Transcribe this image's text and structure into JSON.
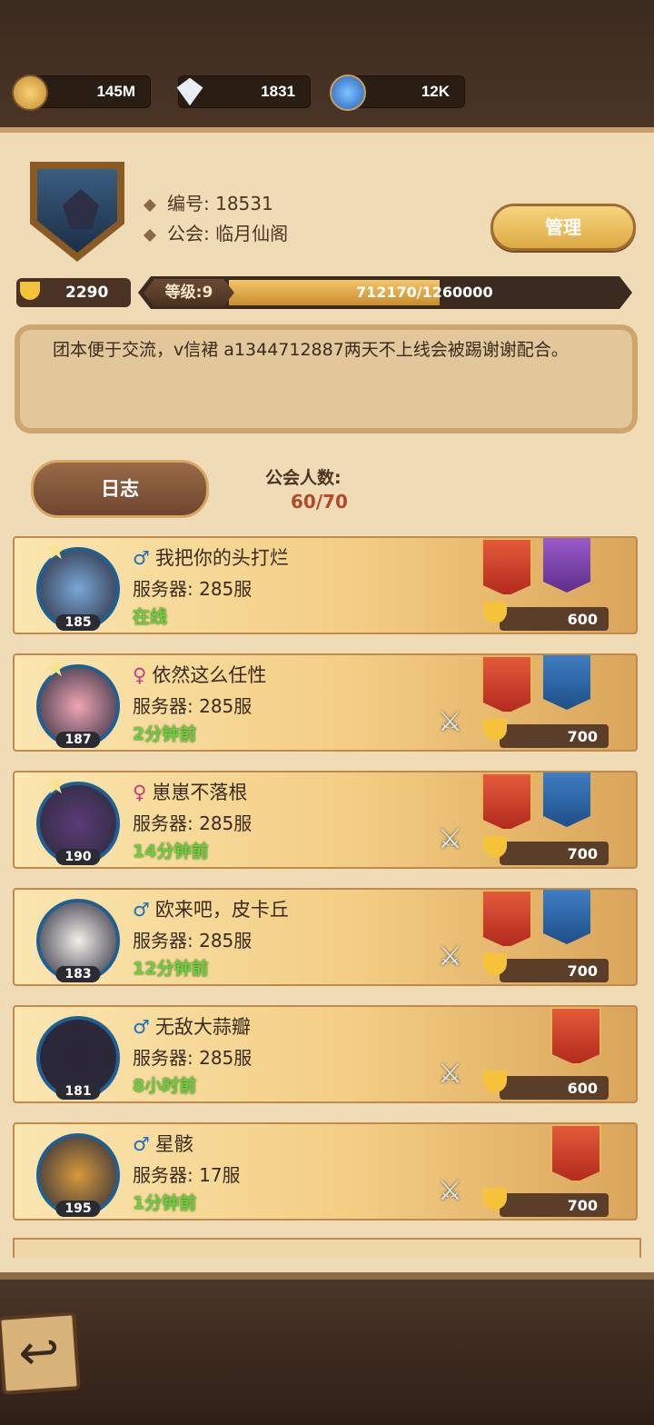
{
  "resources": [
    {
      "icon": "gold-coin-icon",
      "value": "145M"
    },
    {
      "icon": "diamond-icon",
      "value": "1831"
    },
    {
      "icon": "blue-gem-icon",
      "value": "12K"
    }
  ],
  "guild": {
    "id_label": "编号: 18531",
    "name_label": "公会: 临月仙阁",
    "manage_label": "管理",
    "trophies": "2290",
    "level_label": "等级:9",
    "exp": "712170/1260000",
    "exp_fraction": 0.5652,
    "notice": "团本便于交流，v信裙 a1344712887两天不上线会被踢谢谢配合。",
    "log_label": "日志",
    "member_count_label": "公会人数:",
    "member_count": "60/70"
  },
  "members": [
    {
      "gender": "♂",
      "name": "我把你的头打烂",
      "server": "服务器: 285服",
      "status": "在线",
      "level": "185",
      "trophies": "600",
      "banners": [
        "red",
        "purple"
      ],
      "star": true,
      "swords": false
    },
    {
      "gender": "♀",
      "name": "依然这么任性",
      "server": "服务器: 285服",
      "status": "2分钟前",
      "level": "187",
      "trophies": "700",
      "banners": [
        "red",
        "blue"
      ],
      "star": true,
      "swords": true
    },
    {
      "gender": "♀",
      "name": "崽崽不落根",
      "server": "服务器: 285服",
      "status": "14分钟前",
      "level": "190",
      "trophies": "700",
      "banners": [
        "red",
        "blue"
      ],
      "star": true,
      "swords": true
    },
    {
      "gender": "♂",
      "name": "欧来吧，皮卡丘",
      "server": "服务器: 285服",
      "status": "12分钟前",
      "level": "183",
      "trophies": "700",
      "banners": [
        "red",
        "blue"
      ],
      "star": false,
      "swords": true
    },
    {
      "gender": "♂",
      "name": "无敌大蒜瓣",
      "server": "服务器: 285服",
      "status": "8小时前",
      "level": "181",
      "trophies": "600",
      "banners": [
        "red"
      ],
      "star": false,
      "swords": true
    },
    {
      "gender": "♂",
      "name": "星骸",
      "server": "服务器: 17服",
      "status": "1分钟前",
      "level": "195",
      "trophies": "700",
      "banners": [
        "red"
      ],
      "star": false,
      "swords": true
    }
  ],
  "back_icon": "back-arrow-icon"
}
